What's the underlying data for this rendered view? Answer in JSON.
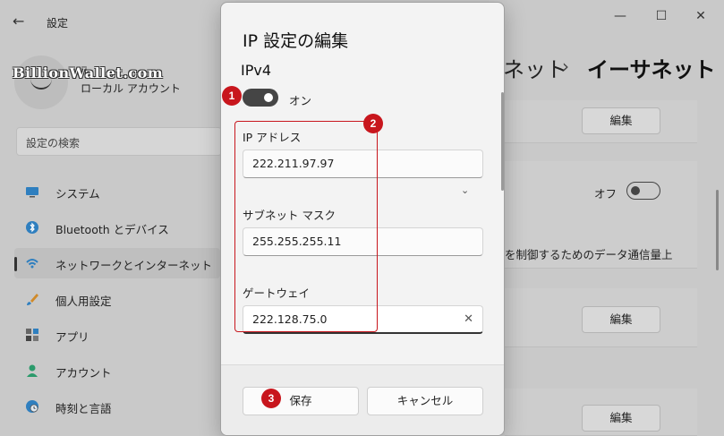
{
  "window": {
    "back_glyph": "←",
    "app_title": "設定",
    "min_glyph": "—",
    "max_glyph": "☐",
    "close_glyph": "✕"
  },
  "watermark": "BillionWallet.com",
  "account": {
    "type": "ローカル アカウント"
  },
  "search": {
    "placeholder": "設定の検索"
  },
  "nav": [
    {
      "label": "システム",
      "icon": "monitor-icon",
      "color": "#2f7fbf"
    },
    {
      "label": "Bluetooth とデバイス",
      "icon": "bluetooth-icon",
      "color": "#2f7fbf"
    },
    {
      "label": "ネットワークとインターネット",
      "icon": "wifi-icon",
      "color": "#2f7fbf",
      "active": true
    },
    {
      "label": "個人用設定",
      "icon": "brush-icon",
      "color": "#d08a2a"
    },
    {
      "label": "アプリ",
      "icon": "apps-icon",
      "color": "#555"
    },
    {
      "label": "アカウント",
      "icon": "person-icon",
      "color": "#2b9a6b"
    },
    {
      "label": "時刻と言語",
      "icon": "globe-clock-icon",
      "color": "#2f7fbf"
    }
  ],
  "breadcrumb": {
    "parent": "ネット",
    "separator": "›",
    "current": "イーサネット"
  },
  "right_panel": {
    "edit_label": "編集",
    "off_label": "オフ",
    "metered_text": "を制御するためのデータ通信量上"
  },
  "dialog": {
    "title": "IP 設定の編集",
    "section": "IPv4",
    "toggle_label": "オン",
    "ip_label": "IP アドレス",
    "ip_value": "222.211.97.97",
    "subnet_label": "サブネット マスク",
    "subnet_value": "255.255.255.11",
    "gateway_label": "ゲートウェイ",
    "gateway_value": "222.128.75.0",
    "clear_glyph": "✕",
    "chevron_glyph": "⌄",
    "save_label": "保存",
    "cancel_label": "キャンセル"
  },
  "badges": {
    "one": "1",
    "two": "2",
    "three": "3"
  },
  "colors": {
    "badge": "#c8161d",
    "toggle_on": "#454545"
  }
}
